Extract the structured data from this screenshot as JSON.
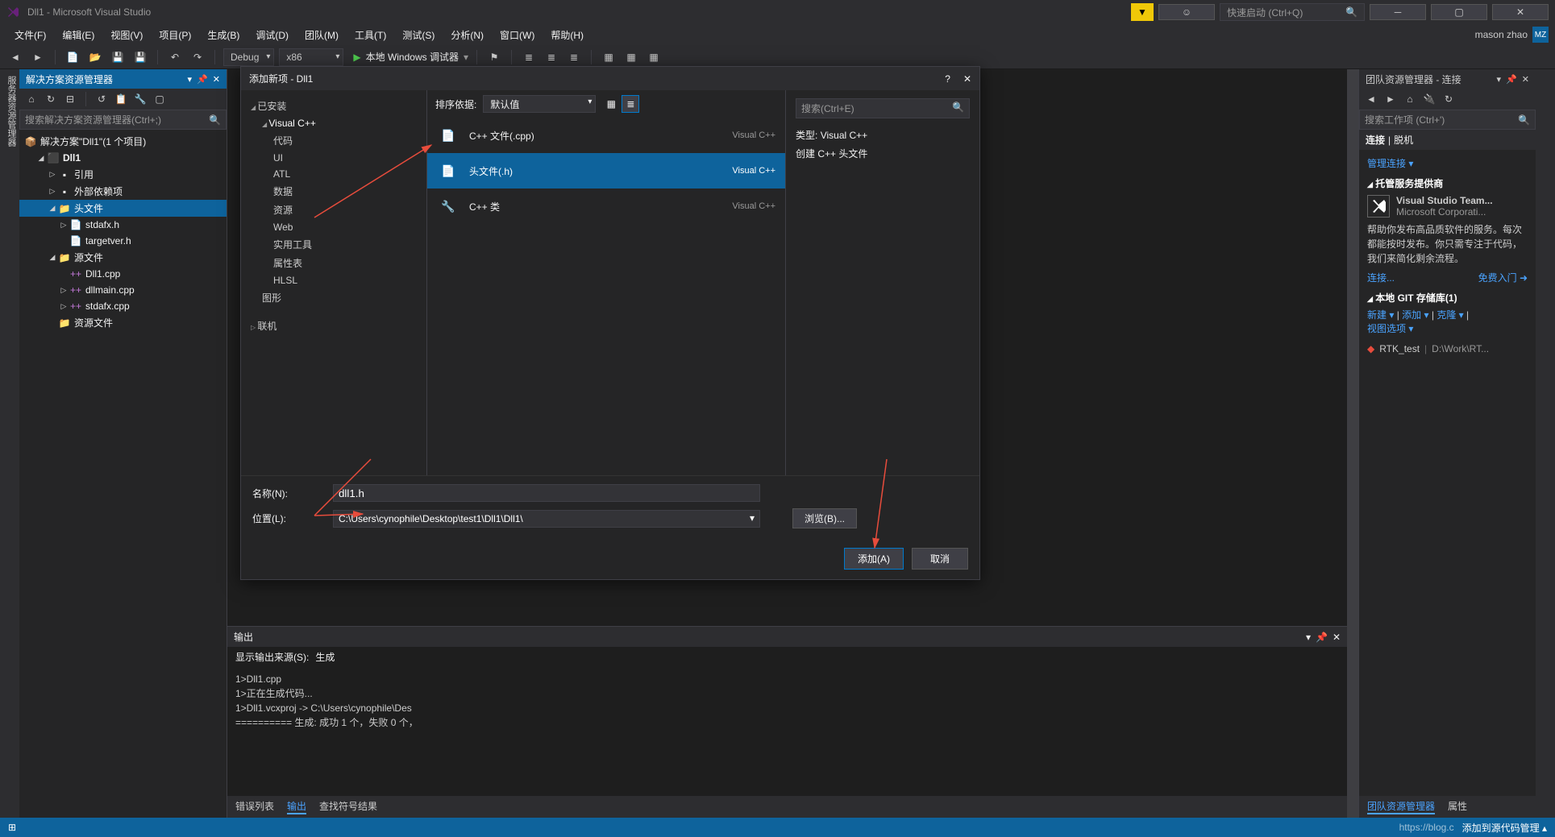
{
  "titlebar": {
    "title": "Dll1 - Microsoft Visual Studio",
    "quick_launch_placeholder": "快速启动 (Ctrl+Q)"
  },
  "user": {
    "name": "mason zhao",
    "initials": "MZ"
  },
  "menu": {
    "file": "文件(F)",
    "edit": "编辑(E)",
    "view": "视图(V)",
    "project": "项目(P)",
    "build": "生成(B)",
    "debug": "调试(D)",
    "team": "团队(M)",
    "tools": "工具(T)",
    "test": "测试(S)",
    "analyze": "分析(N)",
    "window": "窗口(W)",
    "help": "帮助(H)"
  },
  "toolbar": {
    "config": "Debug",
    "platform": "x86",
    "debugger": "本地 Windows 调试器"
  },
  "left_rail": "服务器资源管理器",
  "sol_explorer": {
    "title": "解决方案资源管理器",
    "search_placeholder": "搜索解决方案资源管理器(Ctrl+;)",
    "root": "解决方案\"Dll1\"(1 个项目)",
    "project": "Dll1",
    "refs": "引用",
    "ext": "外部依赖项",
    "headers": "头文件",
    "h1": "stdafx.h",
    "h2": "targetver.h",
    "sources": "源文件",
    "s1": "Dll1.cpp",
    "s2": "dllmain.cpp",
    "s3": "stdafx.cpp",
    "res": "资源文件"
  },
  "output": {
    "title": "输出",
    "label": "显示输出来源(S):",
    "source": "生成",
    "line1": "1>Dll1.cpp",
    "line2": "1>正在生成代码...",
    "line3": "1>Dll1.vcxproj -> C:\\Users\\cynophile\\Des",
    "line4": "========== 生成: 成功 1 个，失败 0 个，"
  },
  "bottom_tabs": {
    "errors": "错误列表",
    "output": "输出",
    "find": "查找符号结果"
  },
  "team": {
    "title": "团队资源管理器 - 连接",
    "search_placeholder": "搜索工作项 (Ctrl+')",
    "connect_hdr": "连接",
    "offline": "脱机",
    "manage": "管理连接 ▾",
    "hosted_hdr": "托管服务提供商",
    "vsteam_title": "Visual Studio Team...",
    "vsteam_sub": "Microsoft Corporati...",
    "blurb": "帮助你发布高品质软件的服务。每次都能按时发布。你只需专注于代码，我们来简化剩余流程。",
    "connect_link": "连接...",
    "free_link": "免费入门",
    "git_hdr": "本地 GIT 存储库(1)",
    "git_new": "新建 ▾",
    "git_add": "添加 ▾",
    "git_clone": "克隆 ▾",
    "git_view": "视图选项 ▾",
    "repo_name": "RTK_test",
    "repo_path": "D:\\Work\\RT..."
  },
  "right_tabs": {
    "team": "团队资源管理器",
    "props": "属性"
  },
  "status": {
    "ready": "",
    "add_src": "添加到源代码管理 ▴",
    "blog": "https://blog.c"
  },
  "dialog": {
    "title": "添加新项 - Dll1",
    "installed": "已安装",
    "vcpp": "Visual C++",
    "cats": {
      "code": "代码",
      "ui": "UI",
      "atl": "ATL",
      "data": "数据",
      "res": "资源",
      "web": "Web",
      "util": "实用工具",
      "prop": "属性表",
      "hlsl": "HLSL",
      "graphics": "图形"
    },
    "online": "联机",
    "sort_label": "排序依据:",
    "sort_value": "默认值",
    "templates": [
      {
        "name": "C++ 文件(.cpp)",
        "group": "Visual C++"
      },
      {
        "name": "头文件(.h)",
        "group": "Visual C++"
      },
      {
        "name": "C++ 类",
        "group": "Visual C++"
      }
    ],
    "search_placeholder": "搜索(Ctrl+E)",
    "type_label": "类型:",
    "type_value": "Visual C++",
    "desc": "创建 C++ 头文件",
    "name_label": "名称(N):",
    "name_value": "dll1.h",
    "loc_label": "位置(L):",
    "loc_value": "C:\\Users\\cynophile\\Desktop\\test1\\Dll1\\Dll1\\",
    "browse": "浏览(B)...",
    "add": "添加(A)",
    "cancel": "取消"
  }
}
